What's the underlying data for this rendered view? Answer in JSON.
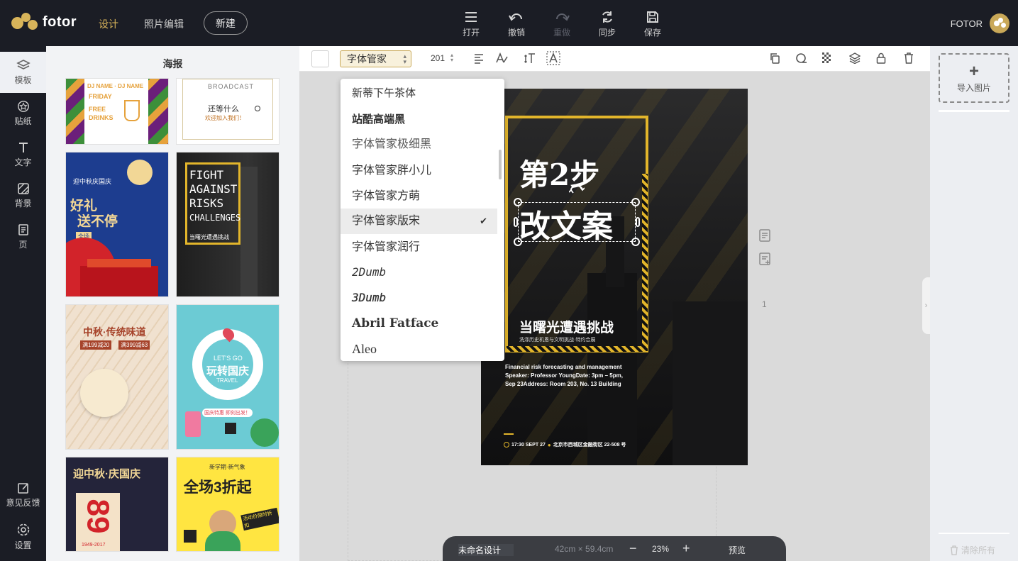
{
  "topbar": {
    "brand": "fotor",
    "tabs": [
      "设计",
      "照片编辑"
    ],
    "new_button": "新建",
    "actions": [
      {
        "label": "打开",
        "icon": "menu-icon",
        "enabled": true
      },
      {
        "label": "撤销",
        "icon": "undo-icon",
        "enabled": true
      },
      {
        "label": "重做",
        "icon": "redo-icon",
        "enabled": false
      },
      {
        "label": "同步",
        "icon": "sync-icon",
        "enabled": true
      },
      {
        "label": "保存",
        "icon": "save-icon",
        "enabled": true
      }
    ],
    "user": "FOTOR"
  },
  "leftnav": {
    "items": [
      {
        "label": "模板",
        "icon": "layers-icon"
      },
      {
        "label": "贴纸",
        "icon": "sticker-icon"
      },
      {
        "label": "文字",
        "icon": "text-icon"
      },
      {
        "label": "背景",
        "icon": "background-icon"
      },
      {
        "label": "页",
        "icon": "page-icon"
      }
    ],
    "bottom": [
      {
        "label": "意见反馈",
        "icon": "feedback-icon"
      },
      {
        "label": "设置",
        "icon": "settings-icon"
      }
    ]
  },
  "panel": {
    "title": "海报",
    "templates": [
      {
        "lines": [
          "DJ NAME · DJ NAME",
          "FRIDAY",
          "FREE",
          "DRINKS"
        ]
      },
      {
        "lines": [
          "BROADCAST",
          "还等什么",
          "欢迎加入我们！"
        ]
      },
      {
        "lines": [
          "迎中秋庆国庆",
          "好礼",
          "送不停",
          "全场"
        ]
      },
      {
        "lines": [
          "FIGHT",
          "AGAINST",
          "RISKS",
          "CHALLENGES",
          "当曙光遭遇挑战"
        ]
      },
      {
        "lines": [
          "中秋·传统味道",
          "满199减20",
          "满399减63"
        ]
      },
      {
        "lines": [
          "LET'S GO",
          "玩转国庆",
          "TRAVEL",
          "国庆特惠 即刻出发！"
        ]
      },
      {
        "lines": [
          "迎中秋·庆国庆",
          "89",
          "1949-2017"
        ]
      },
      {
        "lines": [
          "新学期·新气象",
          "全场3折起",
          "活动价限时折扣"
        ]
      }
    ]
  },
  "format_bar": {
    "font": "字体管家",
    "font_size": "201",
    "tools": [
      "align-icon",
      "letter-spacing-icon",
      "line-height-icon",
      "text-effect-icon",
      "copy-icon",
      "mask-icon",
      "transparency-icon",
      "layers-icon",
      "lock-icon",
      "delete-icon"
    ]
  },
  "font_dropdown": {
    "items": [
      "新蒂下午茶体",
      "站酷高端黑",
      "字体管家极细黑",
      "字体管家胖小儿",
      "字体管家方萌",
      "字体管家版宋",
      "字体管家润行",
      "2Dumb",
      "3Dumb",
      "Abril Fatface",
      "Aleo"
    ],
    "selected": "字体管家版宋",
    "check": "✔"
  },
  "poster": {
    "step": "第2步",
    "headline": "改文案",
    "title": "当曙光遭遇挑战",
    "subtitle": "洗涤历史机恩与文明挑战·特约合展",
    "info_lines": [
      "Financial risk forecasting and management",
      "Speaker: Professor YoungDate: 3pm – 5pm,",
      "Sep 23Address: Room 203, No. 13 Building"
    ],
    "footer_time": "17:30 SEPT 27",
    "footer_place": "北京市西城区金融街区 22-508 号",
    "accent": "#e2b52b"
  },
  "page_tools": {
    "page_number": "1"
  },
  "right_panel": {
    "import_label": "导入图片",
    "clear_label": "清除所有"
  },
  "bottombar": {
    "name": "未命名设计",
    "size": "42cm × 59.4cm",
    "minus": "−",
    "zoom": "23%",
    "plus": "+",
    "preview": "预览"
  },
  "colors": {
    "topbar": "#1b1d25",
    "gold": "#d8b45a",
    "poster_bg": "#1e1e1f"
  }
}
